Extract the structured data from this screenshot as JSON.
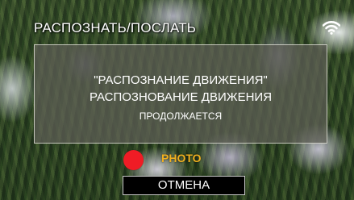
{
  "screen": {
    "title": "РАСПОЗНАТЬ/ПОСЛАТЬ"
  },
  "status": {
    "wifi_icon": "wifi-icon"
  },
  "dialog": {
    "line1": "\"РАСПОЗНАНИЕ ДВИЖЕНИЯ\"",
    "line2": "РАСПОЗНОВАНИЕ ДВИЖЕНИЯ",
    "line3": "ПРОДОЛЖАЕТСЯ"
  },
  "indicator": {
    "label": "PHOTO",
    "dot_color": "#ef1c25",
    "label_color": "#f0b020"
  },
  "actions": {
    "cancel_label": "ОТМЕНА"
  }
}
